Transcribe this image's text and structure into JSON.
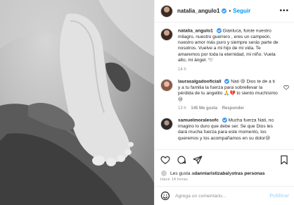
{
  "header": {
    "username": "natalia_angulo1",
    "separator": "•",
    "follow_label": "Seguir",
    "more_label": "•••"
  },
  "caption": {
    "username": "natalia_angulo1",
    "text": "Gianluca, fuiste nuestro milagro, nuestro guerrero , eres un campeón, nuestro amor más puro y siempre serás parte de nosotros. Vuelve a mi hijo de mi vida. Te amaremos por toda la eternidad, mi niño. Vuela alto, mi ángel. 🕊️",
    "time": "14 h"
  },
  "comments": [
    {
      "username": "laurasalgadooficiall",
      "text": "Nati 😢 Dios te de a ti y a tu familia la fuerza para sobrellevar la pérdida de tu angelito 🙏💔 lo siento muchísimo 😢",
      "time": "13 h",
      "likes": "145 Me gusta",
      "reply": "Responder"
    },
    {
      "username": "samuelmoralesofc",
      "text": "Mucha fuerza Nati, no imagino lo duro que debe ser. Se que Dios les dará mucha fuerza para este momento, los queremos y los acompañamos en su dolor😢",
      "time": "",
      "likes": "",
      "reply": ""
    }
  ],
  "likes": {
    "prefix": "Les gusta a ",
    "user": "danniaristizabal",
    "suffix": " y ",
    "others": "otras personas"
  },
  "timestamp": "Hace 14 horas",
  "add_comment": {
    "placeholder": "Agrega un comentario...",
    "publish_label": "Publicar"
  },
  "icons": {
    "like": "heart-icon",
    "comment": "comment-icon",
    "share": "share-icon",
    "save": "bookmark-icon",
    "emoji": "emoji-icon",
    "verified": "verified-badge-icon"
  },
  "colors": {
    "accent": "#0095f6",
    "verified": "#3897f0",
    "muted": "#8e8e8e",
    "publish_disabled": "#b3dbff"
  }
}
